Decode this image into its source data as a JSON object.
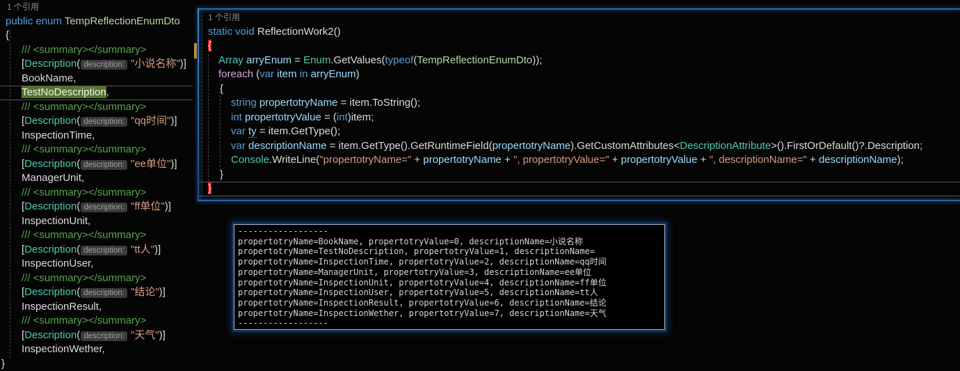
{
  "colors": {
    "background": "#050505",
    "keyword_blue": "#569cd6",
    "control_keyword_pink": "#d8a0df",
    "type_teal": "#4ec9b0",
    "enum_type_green": "#b8d7a3",
    "identifier_blue": "#9cdcfe",
    "string_orange": "#d69d85",
    "comment_green": "#57a64a",
    "plain_text": "#dcdcdc",
    "codelens_gray": "#8a8a8a",
    "highlight_green_bg": "#56742c",
    "brace_highlight_red_bg": "#cb2727",
    "peek_border_blue": "#2e6db4",
    "scrollbar_change_mark_yellow": "#c9992f",
    "console_border": "#a9b9cc"
  },
  "left_editor": {
    "codelens_label": "1 个引用",
    "lines": [
      {
        "cls": "lens-line",
        "indent": 10,
        "name": "codelens-reference-count",
        "tokens": [
          [
            "lens",
            "1 个引用"
          ]
        ]
      },
      {
        "indent": 8,
        "name": "enum-declaration",
        "tokens": [
          [
            "kw",
            "public enum "
          ],
          [
            "enumtype",
            "TempReflectionEnumDto"
          ]
        ]
      },
      {
        "indent": 8,
        "tokens": [
          [
            "txt",
            "{"
          ]
        ]
      },
      {
        "indent": 31,
        "tokens": [
          [
            "cmt",
            "/// <summary></summary>"
          ]
        ]
      },
      {
        "indent": 31,
        "name": "attribute-line",
        "tokens": [
          [
            "txt",
            "["
          ],
          [
            "type",
            "Description"
          ],
          [
            "txt",
            "("
          ],
          [
            "hint",
            "description:"
          ],
          [
            "str",
            "\"小说名称\""
          ],
          [
            "txt",
            ")]"
          ]
        ]
      },
      {
        "indent": 31,
        "name": "enum-member",
        "tokens": [
          [
            "txt",
            "BookName,"
          ]
        ]
      },
      {
        "indent": 31,
        "cls": "current-row",
        "name": "enum-member-highlighted",
        "tokens": [
          [
            "hlgreen",
            "TestNoDescription"
          ],
          [
            "txt",
            ","
          ]
        ]
      },
      {
        "indent": 31,
        "tokens": [
          [
            "cmt",
            "/// <summary></summary>"
          ]
        ]
      },
      {
        "indent": 31,
        "name": "attribute-line",
        "tokens": [
          [
            "txt",
            "["
          ],
          [
            "type",
            "Description"
          ],
          [
            "txt",
            "("
          ],
          [
            "hint",
            "description:"
          ],
          [
            "str",
            "\"qq时间\""
          ],
          [
            "txt",
            ")]"
          ]
        ]
      },
      {
        "indent": 31,
        "name": "enum-member",
        "tokens": [
          [
            "txt",
            "InspectionTime,"
          ]
        ]
      },
      {
        "indent": 31,
        "tokens": [
          [
            "cmt",
            "/// <summary></summary>"
          ]
        ]
      },
      {
        "indent": 31,
        "name": "attribute-line",
        "tokens": [
          [
            "txt",
            "["
          ],
          [
            "type",
            "Description"
          ],
          [
            "txt",
            "("
          ],
          [
            "hint",
            "description:"
          ],
          [
            "str",
            "\"ee单位\""
          ],
          [
            "txt",
            ")]"
          ]
        ]
      },
      {
        "indent": 31,
        "name": "enum-member",
        "tokens": [
          [
            "txt",
            "ManagerUnit,"
          ]
        ]
      },
      {
        "indent": 31,
        "tokens": [
          [
            "cmt",
            "/// <summary></summary>"
          ]
        ]
      },
      {
        "indent": 31,
        "name": "attribute-line",
        "tokens": [
          [
            "txt",
            "["
          ],
          [
            "type",
            "Description"
          ],
          [
            "txt",
            "("
          ],
          [
            "hint",
            "description:"
          ],
          [
            "str",
            "\"ff单位\""
          ],
          [
            "txt",
            ")]"
          ]
        ]
      },
      {
        "indent": 31,
        "name": "enum-member",
        "tokens": [
          [
            "txt",
            "InspectionUnit,"
          ]
        ]
      },
      {
        "indent": 31,
        "tokens": [
          [
            "cmt",
            "/// <summary></summary>"
          ]
        ]
      },
      {
        "indent": 31,
        "name": "attribute-line",
        "tokens": [
          [
            "txt",
            "["
          ],
          [
            "type",
            "Description"
          ],
          [
            "txt",
            "("
          ],
          [
            "hint",
            "description:"
          ],
          [
            "str",
            "\"tt人\""
          ],
          [
            "txt",
            ")]"
          ]
        ]
      },
      {
        "indent": 31,
        "name": "enum-member",
        "tokens": [
          [
            "txt",
            "InspectionUser,"
          ]
        ]
      },
      {
        "indent": 31,
        "tokens": [
          [
            "cmt",
            "/// <summary></summary>"
          ]
        ]
      },
      {
        "indent": 31,
        "name": "attribute-line",
        "tokens": [
          [
            "txt",
            "["
          ],
          [
            "type",
            "Description"
          ],
          [
            "txt",
            "("
          ],
          [
            "hint",
            "description:"
          ],
          [
            "str",
            "\"结论\""
          ],
          [
            "txt",
            ")]"
          ]
        ]
      },
      {
        "indent": 31,
        "name": "enum-member",
        "tokens": [
          [
            "txt",
            "InspectionResult,"
          ]
        ]
      },
      {
        "indent": 31,
        "tokens": [
          [
            "cmt",
            "/// <summary></summary>"
          ]
        ]
      },
      {
        "indent": 31,
        "name": "attribute-line",
        "tokens": [
          [
            "txt",
            "["
          ],
          [
            "type",
            "Description"
          ],
          [
            "txt",
            "("
          ],
          [
            "hint",
            "description:"
          ],
          [
            "str",
            "\"天气\""
          ],
          [
            "txt",
            ")]"
          ]
        ]
      },
      {
        "indent": 31,
        "name": "enum-member",
        "tokens": [
          [
            "txt",
            "InspectionWether,"
          ]
        ]
      },
      {
        "indent": 2,
        "tokens": [
          [
            "txt",
            "}"
          ]
        ]
      }
    ]
  },
  "right_editor": {
    "codelens_label": "1 个引用",
    "lines": [
      {
        "cls": "lens-line",
        "indent": 13,
        "name": "codelens-reference-count",
        "tokens": [
          [
            "lens",
            "1 个引用"
          ]
        ]
      },
      {
        "indent": 13,
        "name": "method-declaration",
        "tokens": [
          [
            "kw",
            "static void "
          ],
          [
            "txt",
            "ReflectionWork2()"
          ]
        ]
      },
      {
        "indent": 13,
        "name": "open-brace-highlighted",
        "tokens": [
          [
            "hlred",
            "{"
          ]
        ]
      },
      {
        "indent": 28,
        "tokens": [
          [
            "type",
            "Array"
          ],
          [
            "txt",
            " "
          ],
          [
            "var",
            "arryEnum"
          ],
          [
            "txt",
            " = "
          ],
          [
            "type",
            "Enum"
          ],
          [
            "txt",
            ".GetValues("
          ],
          [
            "kw",
            "typeof"
          ],
          [
            "txt",
            "("
          ],
          [
            "enumtype",
            "TempReflectionEnumDto"
          ],
          [
            "txt",
            "));"
          ]
        ]
      },
      {
        "indent": 28,
        "tokens": [
          [
            "ctrl",
            "foreach"
          ],
          [
            "txt",
            " ("
          ],
          [
            "kw",
            "var"
          ],
          [
            "txt",
            " "
          ],
          [
            "var",
            "item"
          ],
          [
            "txt",
            " "
          ],
          [
            "kw",
            "in"
          ],
          [
            "txt",
            " "
          ],
          [
            "var",
            "arryEnum"
          ],
          [
            "txt",
            ")"
          ]
        ]
      },
      {
        "indent": 30,
        "tokens": [
          [
            "txt",
            "{"
          ]
        ]
      },
      {
        "indent": 46,
        "tokens": [
          [
            "kw",
            "string"
          ],
          [
            "txt",
            " "
          ],
          [
            "var",
            "propertotryName"
          ],
          [
            "txt",
            " = item.ToString();"
          ]
        ]
      },
      {
        "indent": 46,
        "tokens": [
          [
            "kw",
            "int"
          ],
          [
            "txt",
            " "
          ],
          [
            "var",
            "propertotryValue"
          ],
          [
            "txt",
            " = ("
          ],
          [
            "kw",
            "int"
          ],
          [
            "txt",
            ")item;"
          ]
        ]
      },
      {
        "indent": 46,
        "tokens": [
          [
            "kw",
            "var"
          ],
          [
            "txt",
            " "
          ],
          [
            "varul",
            "ty"
          ],
          [
            "txt",
            " = item.GetType();"
          ]
        ]
      },
      {
        "indent": 46,
        "tokens": [
          [
            "kw",
            "var"
          ],
          [
            "txt",
            " "
          ],
          [
            "var",
            "descriptionName"
          ],
          [
            "txt",
            " = item.GetType().GetRuntimeField("
          ],
          [
            "var",
            "propertotryName"
          ],
          [
            "txt",
            ").GetCustomAttributes<"
          ],
          [
            "type",
            "DescriptionAttribute"
          ],
          [
            "txt",
            ">().FirstOrDefault()?.Description;"
          ]
        ]
      },
      {
        "indent": 46,
        "tokens": [
          [
            "type",
            "Console"
          ],
          [
            "txt",
            ".WriteLine("
          ],
          [
            "str",
            "\"propertotryName=\""
          ],
          [
            "txt",
            " + "
          ],
          [
            "var",
            "propertotryName"
          ],
          [
            "txt",
            " + "
          ],
          [
            "str",
            "\", propertotryValue=\""
          ],
          [
            "txt",
            " + "
          ],
          [
            "var",
            "propertotryValue"
          ],
          [
            "txt",
            " + "
          ],
          [
            "str",
            "\", descriptionName=\""
          ],
          [
            "txt",
            " + "
          ],
          [
            "var",
            "descriptionName"
          ],
          [
            "txt",
            ");"
          ]
        ]
      },
      {
        "indent": 30,
        "tokens": [
          [
            "txt",
            "}"
          ]
        ]
      },
      {
        "indent": 13,
        "cls": "current-row",
        "name": "close-brace-highlighted",
        "tokens": [
          [
            "hlred",
            "}"
          ]
        ]
      }
    ]
  },
  "console_output": {
    "lines": [
      "------------------",
      "propertotryName=BookName, propertotryValue=0, descriptionName=小说名称",
      "propertotryName=TestNoDescription, propertotryValue=1, descriptionName=",
      "propertotryName=InspectionTime, propertotryValue=2, descriptionName=qq时间",
      "propertotryName=ManagerUnit, propertotryValue=3, descriptionName=ee单位",
      "propertotryName=InspectionUnit, propertotryValue=4, descriptionName=ff单位",
      "propertotryName=InspectionUser, propertotryValue=5, descriptionName=tt人",
      "propertotryName=InspectionResult, propertotryValue=6, descriptionName=结论",
      "propertotryName=InspectionWether, propertotryValue=7, descriptionName=天气",
      "------------------"
    ]
  }
}
